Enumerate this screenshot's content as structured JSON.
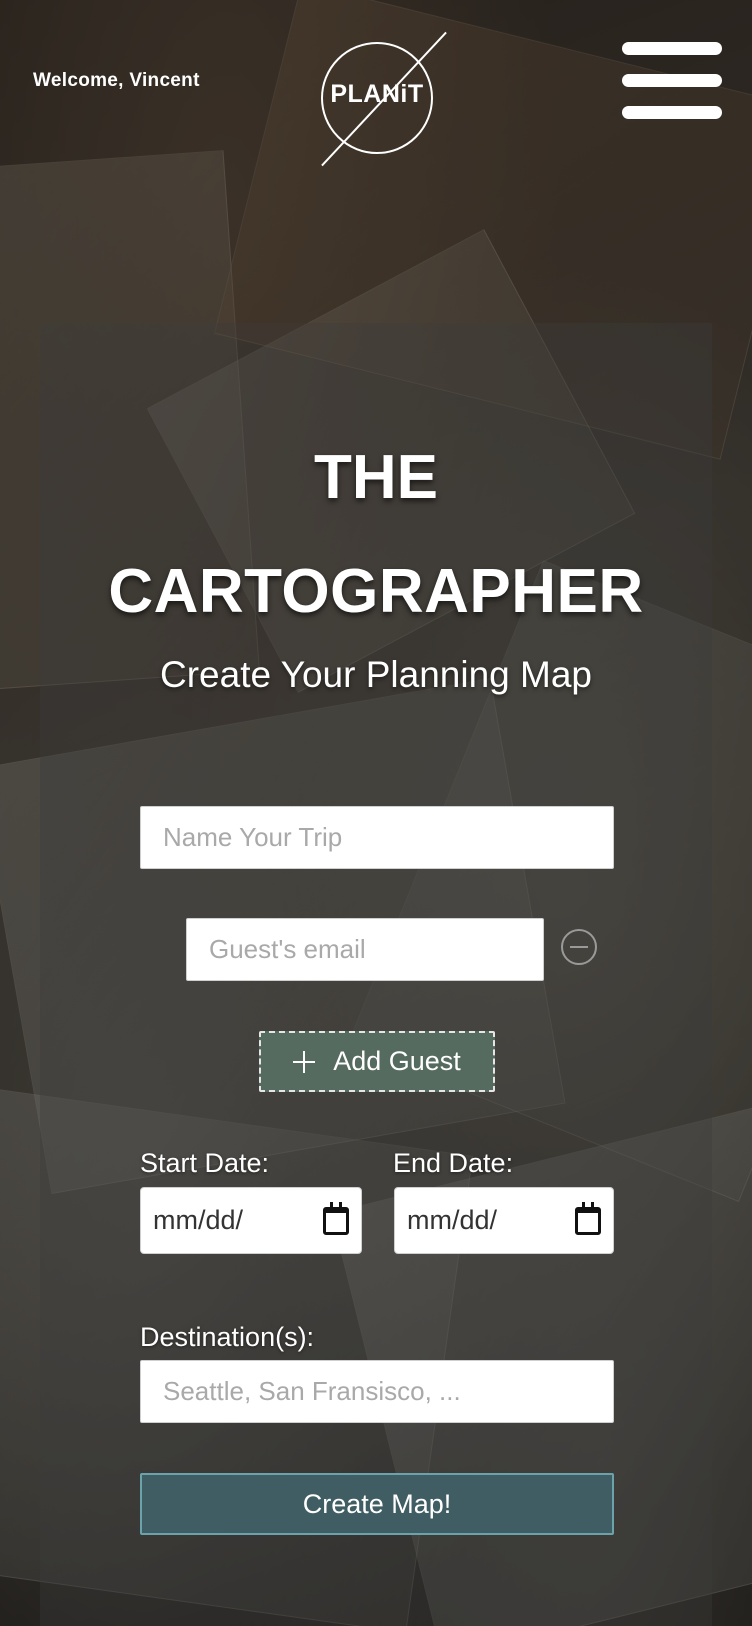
{
  "header": {
    "welcome_text": "Welcome, Vincent",
    "logo_text": "PLANiT",
    "menu_icon": "hamburger-menu-icon"
  },
  "hero": {
    "title_line1": "THE",
    "title_line2": "CARTOGRAPHER",
    "subtitle": "Create Your Planning Map"
  },
  "form": {
    "trip_name_placeholder": "Name Your Trip",
    "guest_email_placeholder": "Guest's email",
    "remove_guest_icon": "minus-circle-icon",
    "add_guest_label": "Add Guest",
    "add_guest_icon": "plus-icon",
    "start_date_label": "Start Date:",
    "start_date_value": "mm/dd/",
    "end_date_label": "End Date:",
    "end_date_value": "mm/dd/",
    "calendar_icon": "calendar-icon",
    "destinations_label": "Destination(s):",
    "destinations_placeholder": "Seattle, San Fransisco, ...",
    "submit_label": "Create Map!"
  },
  "colors": {
    "add_guest_bg": "#566b5f",
    "submit_bg": "#3f5d63",
    "submit_border": "#6aa3ab"
  }
}
